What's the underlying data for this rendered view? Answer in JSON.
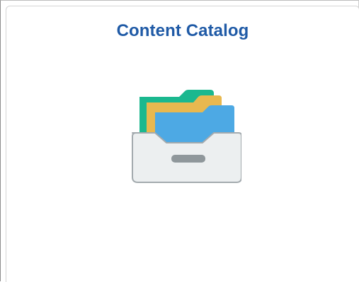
{
  "tile": {
    "title": "Content Catalog",
    "icon": "folder-drawer-icon"
  },
  "colors": {
    "title": "#1f5aa6",
    "folder_back": "#1bb88f",
    "folder_middle": "#e8b84f",
    "folder_front": "#4da9e4",
    "drawer": "#eceff0",
    "drawer_border": "#a3aaae",
    "handle": "#8f979b"
  }
}
